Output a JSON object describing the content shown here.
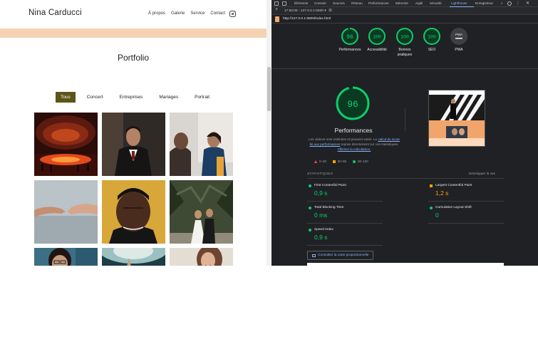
{
  "website": {
    "logo": "Nina Carducci",
    "nav": [
      "À propos",
      "Galerie",
      "Service",
      "Contact"
    ],
    "instagram_icon": "instagram-icon",
    "banner_color": "#f5d2b3",
    "portfolio_title": "Portfolio",
    "filters": [
      "Tous",
      "Concert",
      "Entreprises",
      "Mariages",
      "Portrait"
    ],
    "active_filter": "Tous",
    "active_filter_color": "#5c5419",
    "gallery": [
      "concert-hall-photo",
      "businessman-portrait-photo",
      "women-office-photo",
      "hands-reaching-photo",
      "man-portrait-photo",
      "wedding-couple-photo",
      "woman-glasses-photo",
      "crowd-hands-photo",
      "smiling-woman-photo"
    ]
  },
  "devtools": {
    "tabs": [
      "Éléments",
      "Console",
      "Sources",
      "Réseau",
      "Performances",
      "Mémoire",
      "Appli",
      "Sécurité",
      "Lighthouse",
      "Enregistreur"
    ],
    "active_tab": "Lighthouse",
    "more_tabs": "»",
    "report_selector": "17:50:05 - 127.0.0.1:5500",
    "url": "http://127.0.0.1:5500/index.html",
    "scores": [
      {
        "label": "Performances",
        "value": "96"
      },
      {
        "label": "Accessibilité",
        "value": "100"
      },
      {
        "label": "Bonnes pratiques",
        "value": "100"
      },
      {
        "label": "SEO",
        "value": "100"
      },
      {
        "label": "PWA",
        "value": "PWA"
      }
    ],
    "main_score": "96",
    "main_title": "Performances",
    "desc_part1": "Les valeurs sont estimées et peuvent varier. Le",
    "desc_link1": "calcul du score lié aux performances",
    "desc_part2": "repose directement sur ces statistiques.",
    "desc_link2": "Affichez la calculatrice.",
    "legend": [
      "0–49",
      "50–89",
      "90–100"
    ],
    "stats_title": "STATISTIQUES",
    "stats_expand": "Développer la vue",
    "metrics": [
      {
        "name": "First Contentful Paint",
        "value": "0,9 s",
        "status": "good"
      },
      {
        "name": "Largest Contentful Paint",
        "value": "1,2 s",
        "status": "average"
      },
      {
        "name": "Total Blocking Time",
        "value": "0 ms",
        "status": "good"
      },
      {
        "name": "Cumulative Layout Shift",
        "value": "0",
        "status": "good"
      },
      {
        "name": "Speed Index",
        "value": "0,9 s",
        "status": "good"
      }
    ],
    "treemap_button": "Consultez la carte proportionnelle",
    "colors": {
      "good": "#0cce6b",
      "average": "#ffa400",
      "poor": "#ff4e42",
      "link": "#8ab4f8",
      "bg": "#202124"
    }
  }
}
